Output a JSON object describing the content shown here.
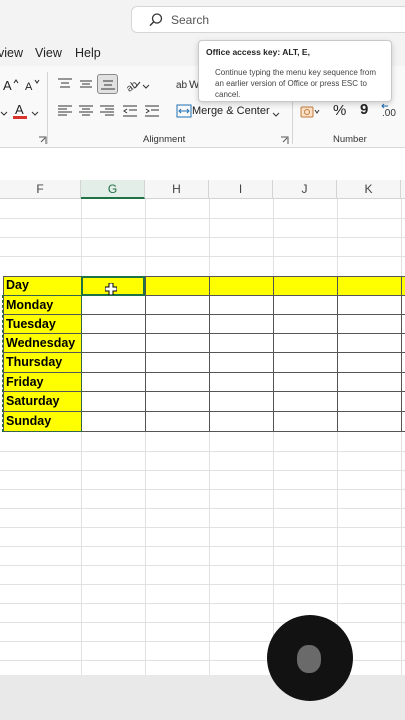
{
  "search": {
    "label": "Search"
  },
  "menu": {
    "items": [
      "view",
      "View",
      "Help"
    ]
  },
  "tooltip": {
    "title": "Office access key: ALT, E,",
    "body": "Continue typing the menu key sequence from an earlier version of Office or press ESC to cancel."
  },
  "ribbon": {
    "merge_center": "Merge & Center",
    "wrap_partial": "W",
    "alignment_label": "Alignment",
    "number_label": "Number",
    "percent": "%",
    "comma": "9",
    "decimal": ".00"
  },
  "sheet": {
    "columns": [
      "F",
      "G",
      "H",
      "I",
      "J",
      "K"
    ],
    "selected_column": "G",
    "header_label": "Day",
    "days": [
      "Monday",
      "Tuesday",
      "Wednesday",
      "Thursday",
      "Friday",
      "Saturday",
      "Sunday"
    ],
    "highlight_color": "#ffff00",
    "accent_color": "#1f7245"
  }
}
